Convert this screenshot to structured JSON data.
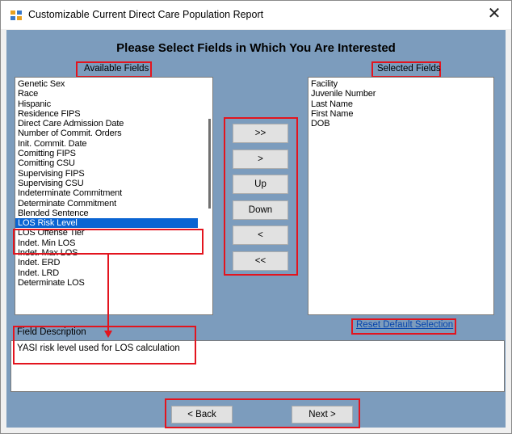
{
  "window": {
    "title": "Customizable Current Direct Care Population Report",
    "close_glyph": "✕"
  },
  "heading": "Please Select Fields in Which You Are Interested",
  "available": {
    "label": "Available Fields",
    "items": [
      "Genetic Sex",
      "Race",
      "Hispanic",
      "Residence FIPS",
      "Direct Care Admission Date",
      "Number of Commit. Orders",
      "Init. Commit. Date",
      "Comitting FIPS",
      "Comitting CSU",
      "Supervising FIPS",
      "Supervising CSU",
      "Indeterminate Commitment",
      "Determinate Commitment",
      "Blended Sentence",
      "LOS Risk Level",
      "LOS Offense Tier",
      "Indet. Min LOS",
      "Indet. Max LOS",
      "Indet. ERD",
      "Indet. LRD",
      "Determinate LOS"
    ],
    "selected_item": "LOS Risk Level"
  },
  "buttons": {
    "add_all": ">>",
    "add": ">",
    "up": "Up",
    "down": "Down",
    "remove": "<",
    "remove_all": "<<"
  },
  "selected": {
    "label": "Selected Fields",
    "items": [
      "Facility",
      "Juvenile Number",
      "Last Name",
      "First Name",
      "DOB"
    ]
  },
  "reset_link": "Reset Default Selection",
  "description": {
    "label": "Field Description",
    "text": "YASI risk level used for LOS calculation"
  },
  "nav": {
    "back": "< Back",
    "next": "Next >"
  },
  "colors": {
    "client_background": "#7c9cbd",
    "highlight_border": "#e3141e",
    "selection": "#0a64d2",
    "link": "#0645ad"
  },
  "icons": {
    "app": "app-window-icon",
    "close": "close-icon"
  }
}
